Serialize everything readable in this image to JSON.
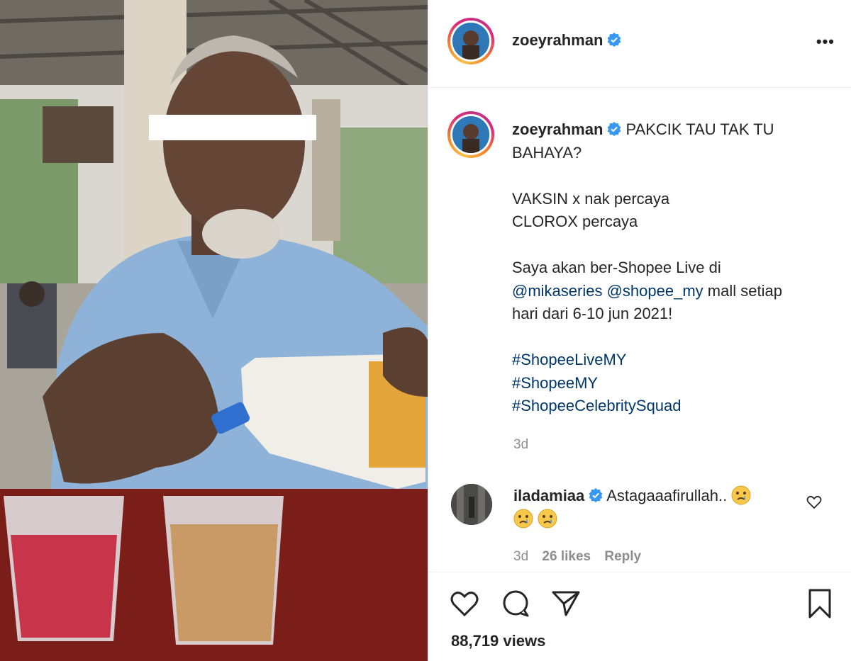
{
  "post": {
    "username": "zoeyrahman",
    "caption_lines": [
      "PAKCIK TAU TAK TU",
      "BAHAYA?",
      "",
      "VAKSIN x nak percaya",
      "CLOROX percaya",
      "",
      "Saya akan ber-Shopee Live di",
      "",
      "hari dari 6-10 jun 2021!",
      ""
    ],
    "mention_1": "@mikaseries",
    "mention_2": "@shopee_my",
    "mention_suffix": " mall setiap",
    "hashtags": [
      "#ShopeeLiveMY",
      "#ShopeeMY",
      "#ShopeeCelebritySquad"
    ],
    "caption_time": "3d"
  },
  "comment": {
    "username": "iladamiaa",
    "text": "Astagaaafirullah..",
    "emoji_name": "crying-face",
    "time": "3d",
    "likes": "26 likes",
    "reply": "Reply"
  },
  "actions": {
    "views": "88,719 views"
  },
  "colors": {
    "accent_link": "#00376b",
    "verified": "#3897f0",
    "muted": "#8e8e8e"
  },
  "icons": [
    "verified-badge-icon",
    "more-options-icon",
    "heart-icon",
    "comment-icon",
    "share-icon",
    "bookmark-icon",
    "crying-face-emoji"
  ]
}
